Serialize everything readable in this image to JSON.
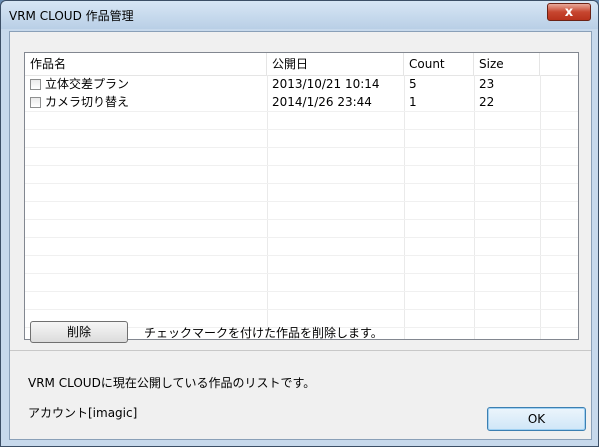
{
  "window": {
    "title": "VRM CLOUD 作品管理",
    "close_label": "x"
  },
  "list": {
    "columns": [
      "作品名",
      "公開日",
      "Count",
      "Size"
    ],
    "rows": [
      {
        "name": "立体交差プラン",
        "date": "2013/10/21 10:14",
        "count": "5",
        "size": "23"
      },
      {
        "name": "カメラ切り替え",
        "date": "2014/1/26 23:44",
        "count": "1",
        "size": "22"
      }
    ]
  },
  "delete_button": {
    "label": "削除"
  },
  "delete_hint": "チェックマークを付けた作品を削除します。",
  "info_text": "VRM CLOUDに現在公開している作品のリストです。",
  "account_text": "アカウント[imagic]",
  "ok_button": {
    "label": "OK"
  }
}
